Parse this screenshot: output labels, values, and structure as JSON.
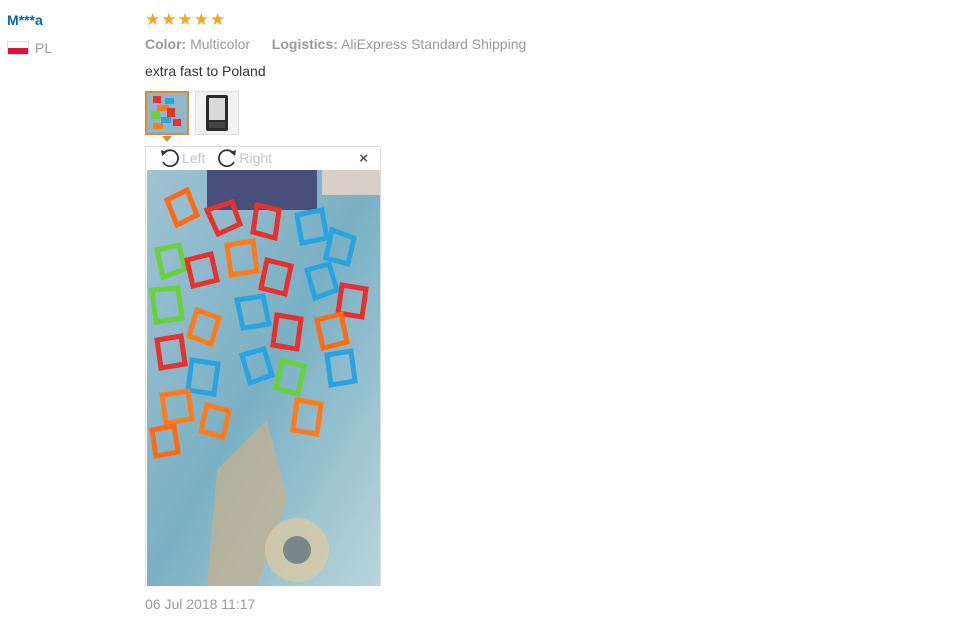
{
  "review": {
    "user_name": "M***a",
    "country": "PL",
    "rating": 5,
    "attributes": {
      "color_label": "Color:",
      "color_value": "Multicolor",
      "logistics_label": "Logistics:",
      "logistics_value": "AliExpress Standard Shipping"
    },
    "text": "extra fast to Poland",
    "date": "06 Jul 2018 11:17"
  },
  "viewer": {
    "rotate_left_label": "Left",
    "rotate_right_label": "Right",
    "close_glyph": "×"
  },
  "icons": {
    "star": "star-icon",
    "flag": "flag-pl-icon",
    "rotate_left": "rotate-left-icon",
    "rotate_right": "rotate-right-icon",
    "close": "close-icon"
  },
  "colors": {
    "user_link": "#0c62b0",
    "star": "#f6a623",
    "active_thumb_border": "#d78b37",
    "meta_gray": "#999999"
  }
}
